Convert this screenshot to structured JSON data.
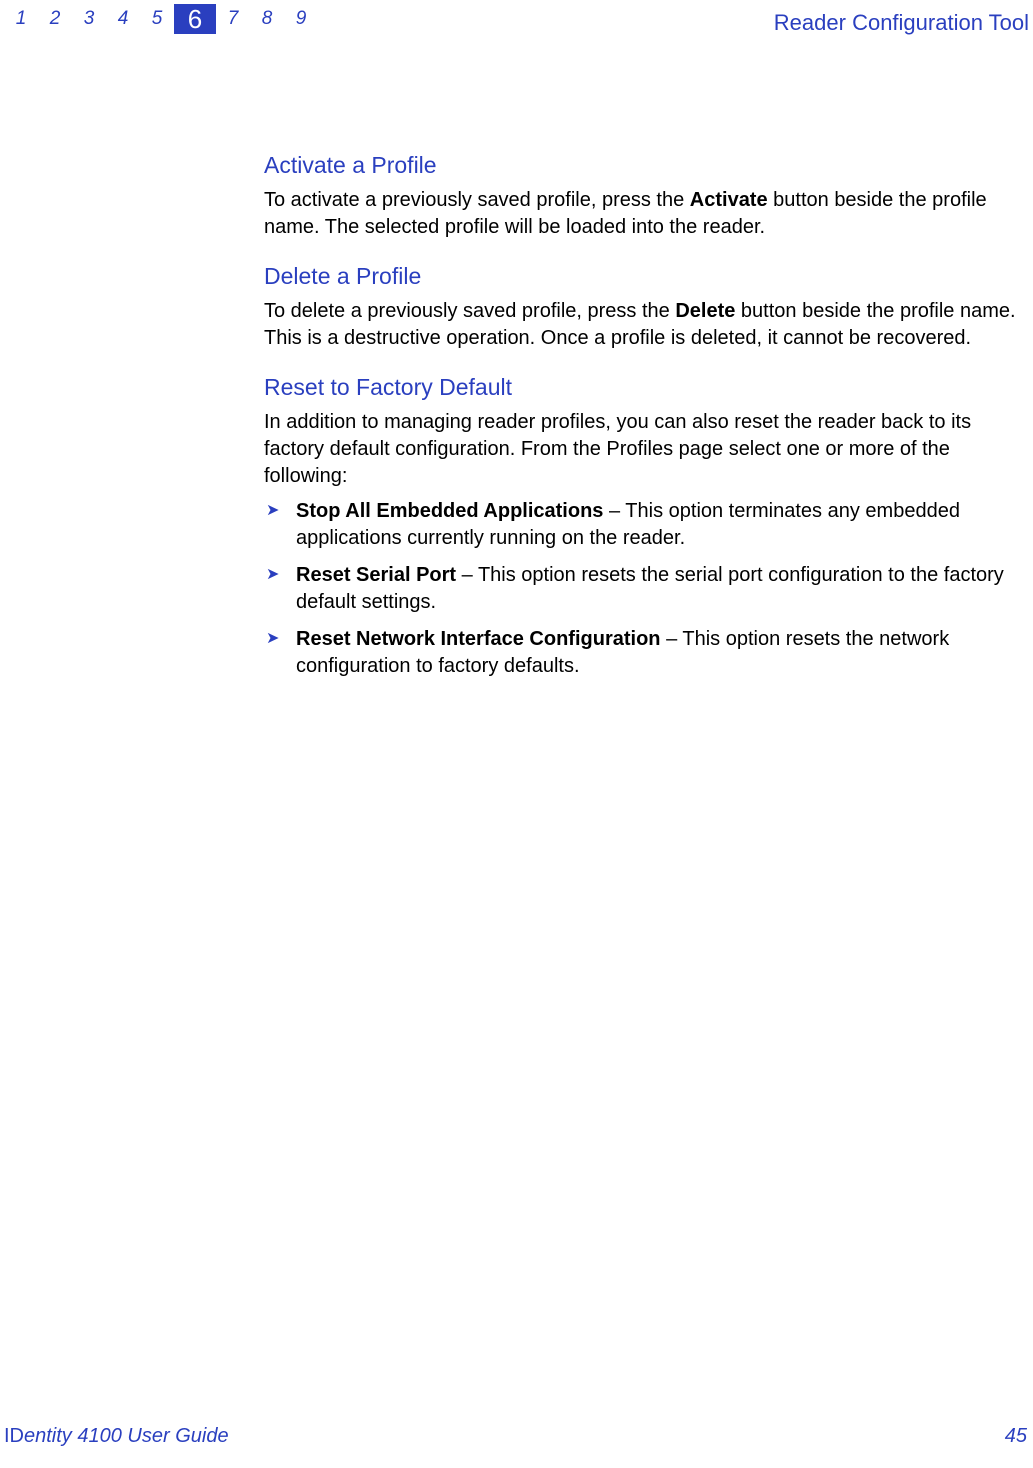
{
  "header": {
    "chapters": [
      "1",
      "2",
      "3",
      "4",
      "5",
      "6",
      "7",
      "8",
      "9"
    ],
    "current_chapter": "6",
    "doc_title": "Reader Configuration Tool"
  },
  "sections": {
    "activate": {
      "heading": "Activate a Profile",
      "para_pre": "To activate a previously saved profile, press the ",
      "bold": "Activate",
      "para_post": " button beside the profile name. The selected profile will be loaded into the reader."
    },
    "delete": {
      "heading": "Delete a Profile",
      "para_pre": "To delete a previously saved profile, press the ",
      "bold": "Delete",
      "para_post": " button beside the profile name. This is a destructive operation. Once a profile is deleted, it cannot be recovered."
    },
    "reset": {
      "heading": "Reset to Factory Default",
      "intro": "In addition to managing reader profiles, you can also reset the reader back to its factory default configuration. From the Profiles page select one or more of the following:",
      "items": {
        "i0": {
          "bold": "Stop All Embedded Applications",
          "rest": " – This option terminates any embedded applications currently running on the reader."
        },
        "i1": {
          "bold": "Reset Serial Port",
          "rest": " – This option resets the serial port configuration to the factory default settings."
        },
        "i2": {
          "bold": "Reset Network Interface Configuration",
          "rest": " – This option resets the network configuration to factory defaults."
        }
      }
    }
  },
  "footer": {
    "left_id": "ID",
    "left_entity": "entity",
    "left_rest": " 4100 User Guide",
    "page": "45"
  }
}
